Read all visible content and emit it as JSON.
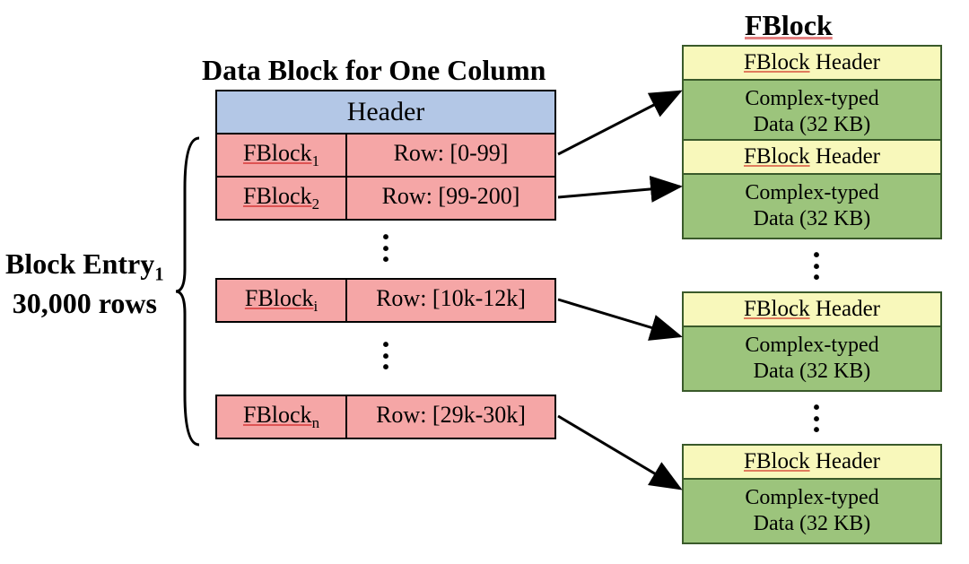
{
  "titles": {
    "fblock": "FBlock",
    "data_block": "Data Block for One Column"
  },
  "left_label": {
    "line1": "Block Entry",
    "sub": "1",
    "line2": "30,000 rows"
  },
  "data_block": {
    "header": "Header",
    "rows": [
      {
        "fblock_label": "FBlock",
        "fblock_sub": "1",
        "row_label": "Row: [0-99]"
      },
      {
        "fblock_label": "FBlock",
        "fblock_sub": "2",
        "row_label": "Row: [99-200]"
      },
      {
        "fblock_label": "FBlock",
        "fblock_sub": "i",
        "row_label": "Row: [10k-12k]"
      },
      {
        "fblock_label": "FBlock",
        "fblock_sub": "n",
        "row_label": "Row: [29k-30k]"
      }
    ]
  },
  "fblock_box": {
    "header_prefix": "FBlock",
    "header_suffix": " Header",
    "body_line1": "Complex-typed",
    "body_line2": "Data (32 KB)"
  }
}
